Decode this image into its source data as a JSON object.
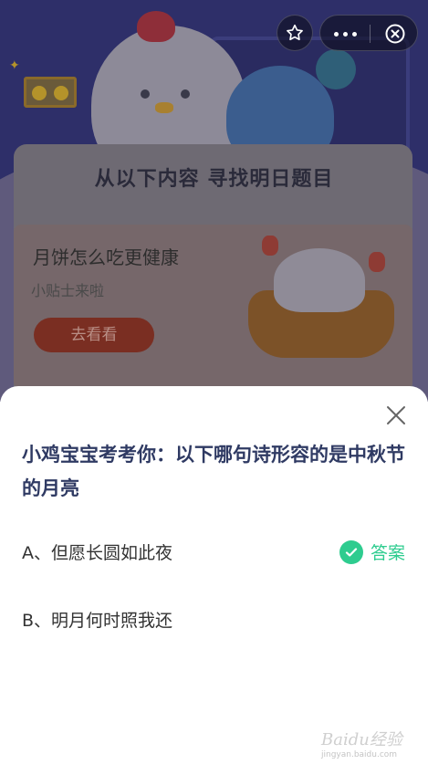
{
  "background": {
    "find_title": "从以下内容 寻找明日题目",
    "promo": {
      "title": "月饼怎么吃更健康",
      "subtitle": "小贴士来啦",
      "button_label": "去看看"
    }
  },
  "topbar": {
    "favorite_icon": "star-outline-icon",
    "more_icon": "more-dots-icon",
    "close_icon": "circle-close-icon"
  },
  "sheet": {
    "question": "小鸡宝宝考考你：以下哪句诗形容的是中秋节的月亮",
    "options": [
      {
        "label": "A、但愿长圆如此夜",
        "is_answer": true
      },
      {
        "label": "B、明月何时照我还",
        "is_answer": false
      }
    ],
    "answer_label": "答案",
    "accent_color": "#2ecc8f",
    "question_color": "#2f3a63"
  },
  "watermark": {
    "main": "Baidu经验",
    "url": "jingyan.baidu.com"
  }
}
